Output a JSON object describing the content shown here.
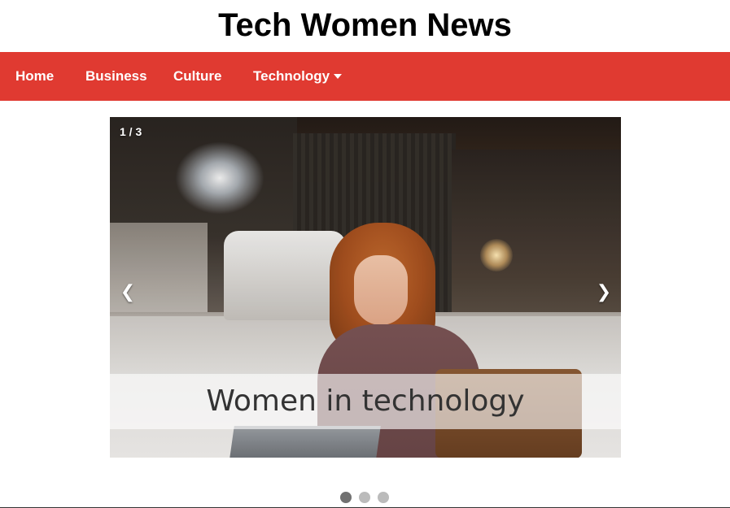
{
  "site": {
    "title": "Tech Women News"
  },
  "nav": {
    "items": [
      {
        "label": "Home"
      },
      {
        "label": "Business"
      },
      {
        "label": "Culture"
      },
      {
        "label": "Technology",
        "dropdown": true
      }
    ]
  },
  "slideshow": {
    "counter": "1 / 3",
    "caption": "Women in technology",
    "prev_glyph": "❮",
    "next_glyph": "❯",
    "total_slides": 3,
    "active_slide": 1,
    "image_description": "woman with red hair smiling at a laptop in a cafe"
  },
  "colors": {
    "nav_bg": "#e03a31",
    "dot_active": "#717171",
    "dot_inactive": "#bbbbbb"
  }
}
